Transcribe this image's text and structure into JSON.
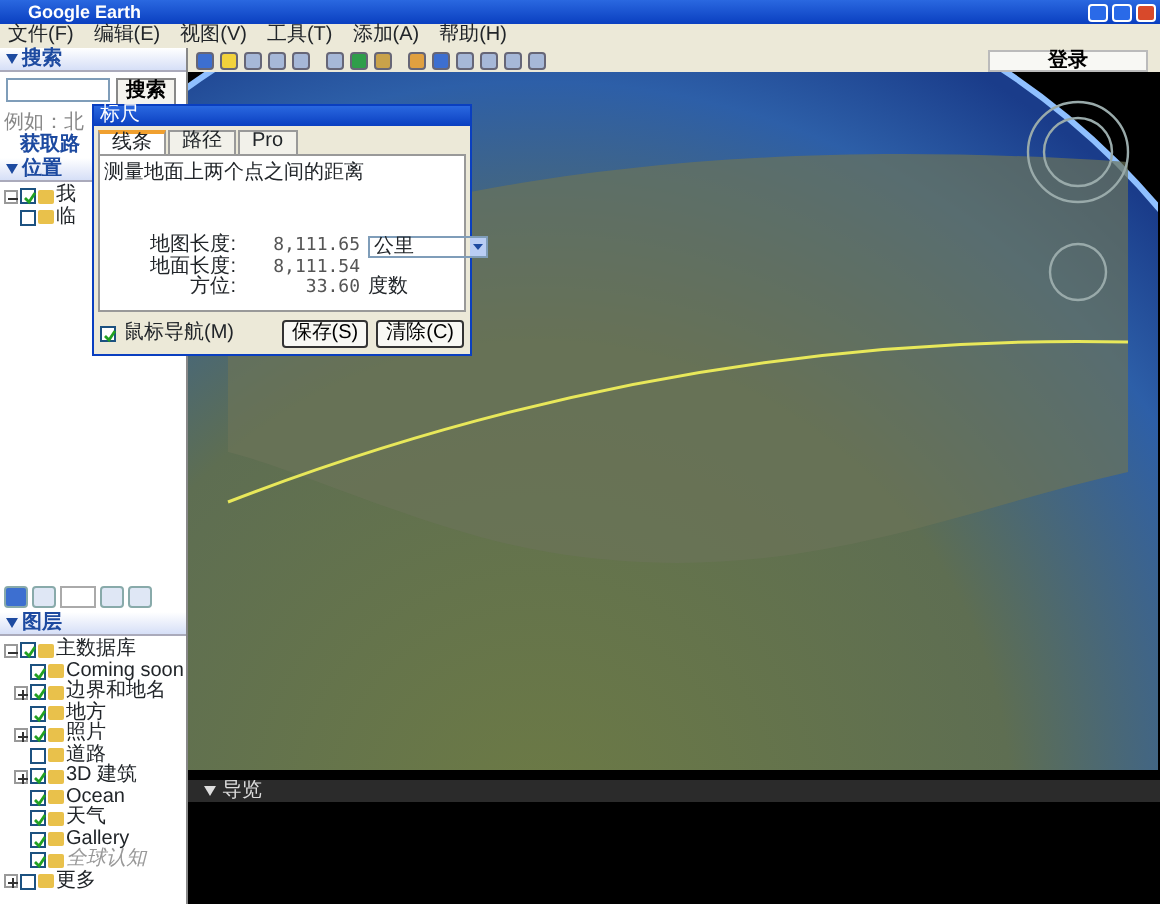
{
  "window": {
    "title": "Google Earth"
  },
  "menu": [
    "文件(F)",
    "编辑(E)",
    "视图(V)",
    "工具(T)",
    "添加(A)",
    "帮助(H)"
  ],
  "toolbar": {
    "sign_in": "登录"
  },
  "search_panel": {
    "header": "搜索",
    "button": "搜索",
    "hint": "例如：北",
    "directions": "获取路"
  },
  "places_panel": {
    "header": "位置",
    "items": [
      {
        "label": "我",
        "checked": true,
        "expanded": true
      },
      {
        "label": "临",
        "checked": false
      }
    ]
  },
  "layers_panel": {
    "header": "图层",
    "items": [
      {
        "label": "主数据库",
        "checked": true,
        "expanded": true,
        "children": [
          {
            "label": "Coming soon",
            "checked": true
          },
          {
            "label": "边界和地名",
            "checked": true,
            "expanded": false
          },
          {
            "label": "地方",
            "checked": true
          },
          {
            "label": "照片",
            "checked": true,
            "expanded": false
          },
          {
            "label": "道路",
            "checked": false
          },
          {
            "label": "3D 建筑",
            "checked": true,
            "expanded": false
          },
          {
            "label": "Ocean",
            "checked": true
          },
          {
            "label": "天气",
            "checked": true
          },
          {
            "label": "Gallery",
            "checked": true
          },
          {
            "label": "全球认知",
            "checked": true,
            "muted": true
          }
        ]
      },
      {
        "label": "更多",
        "checked": false,
        "expanded": false
      }
    ]
  },
  "ruler_dialog": {
    "title": "标尺",
    "tabs": [
      {
        "label": "线条",
        "selected": true
      },
      {
        "label": "路径",
        "selected": false
      },
      {
        "label": "Pro",
        "selected": false
      }
    ],
    "description": "测量地面上两个点之间的距离",
    "rows": [
      {
        "label": "地图长度:",
        "value": "8,111.65"
      },
      {
        "label": "地面长度:",
        "value": "8,111.54"
      },
      {
        "label": "方位:",
        "value": "33.60",
        "unit": "度数"
      }
    ],
    "unit_select": "公里",
    "mouse_navigation": {
      "label": "鼠标导航(M)",
      "checked": true
    },
    "buttons": [
      "保存(S)",
      "清除(C)"
    ]
  },
  "tour_bar": {
    "label": "导览"
  }
}
